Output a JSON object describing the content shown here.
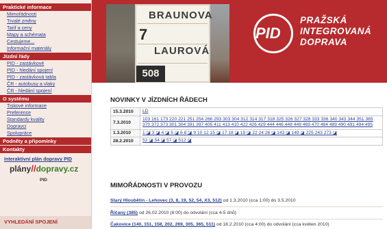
{
  "sidebar": {
    "sections": [
      {
        "title": "Praktické informace",
        "links": [
          "Mimořádnosti",
          "Trvalé změny",
          "Tarif a ceny",
          "Mapy a schémata",
          "Cestujeme...",
          "Informační materiály"
        ]
      },
      {
        "title": "Jízdní řády",
        "links": [
          "PID - zastávkové",
          "PID - hledání spojení",
          "PID - zastávková tabla",
          "ČR - autobusy a vlaky",
          "ČR - hledání spojení"
        ]
      },
      {
        "title": "O systému",
        "links": [
          "Tiskové informace",
          "Preference",
          "Standardy kvality",
          "Dopravci",
          "Spolupráce"
        ]
      },
      {
        "title": "Podněty a připomínky",
        "links": []
      },
      {
        "title": "Kontakty",
        "links": []
      }
    ],
    "interactive_plan": "Interaktivní plán dopravy PID",
    "plany_logo": {
      "left": "plány",
      "slash": "//",
      "right": "dopravy.cz",
      "sub": "PID"
    },
    "search_title": "VYHLEDÁNÍ SPOJENÍ"
  },
  "header": {
    "sign": {
      "top": "BRAUNOVA",
      "number": "7",
      "mid": "LAUROVÁ",
      "line": "508"
    },
    "logo_mark": "PID",
    "logo_lines": [
      "PRAŽSKÁ",
      "INTEGROVANÁ",
      "DOPRAVA"
    ]
  },
  "news": {
    "title": "NOVINKY V JÍZDNÍCH ŘÁDECH",
    "rows": [
      {
        "date": "15.3.2010",
        "value": "LD"
      },
      {
        "date": "7.3.2010",
        "value": "103 161 173 220 221 251 254 266 293 303 304 312 314 317 318 325 326 327 328 333 336 340 343 344 351 365 370 372 373 301 304 391 397 405 411 413 410 422 426 429 444 446 448 449 469 470 484 489 490 491 494 495"
      },
      {
        "date": "1.3.2010",
        "value": "1 ◪ 3 ◪ 4 ◪ 5 ◪ 6 8 ◪ 9 10 12 15 ◪ 17 18 ◪ 19 ◪ 22 24 26 ◪ 143 ◪ 149 ◪ 225 243 273 ◪"
      },
      {
        "date": "28.2.2010",
        "value": "52 ◪ 54 ◪ 57 ◪ 512 ◪"
      }
    ]
  },
  "disruptions": {
    "title": "MIMOŘÁDNOSTI V PROVOZU",
    "items": [
      {
        "link": "Starý Hloubětín - Lehovec (3, 8, 19, 52, 54, X3, 512)",
        "text": "od 1.3.2010 (cca 1:00) do 3.5.2010"
      },
      {
        "link": "Říčany (385)",
        "text": "od 26.02.2010 (8:00) do odvolání (cca 4-5 dnů)"
      },
      {
        "link": "Čakovice (140, 151, 158, 202, 269, 305, 365, 511)",
        "text": "od 18.2.2010 (cca 4:00) do odvolání (cca květen 2010)"
      }
    ]
  },
  "colors": {
    "brand_red": "#b72a2d",
    "link_blue": "#2a3f8f",
    "sidebar_bg": "#f6ebe4"
  }
}
